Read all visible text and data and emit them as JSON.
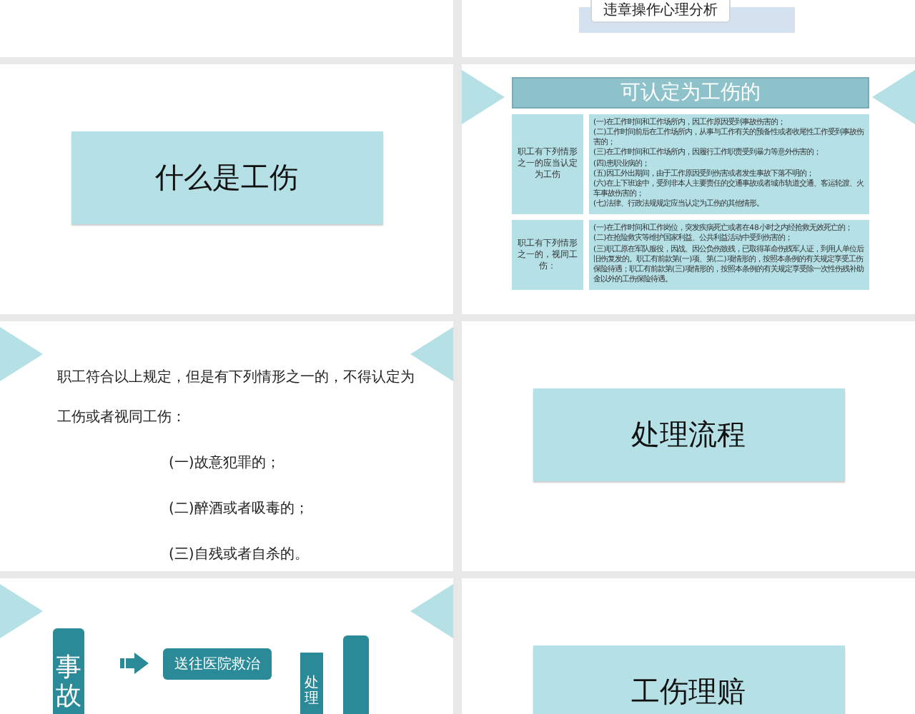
{
  "slides": [
    {
      "kind": "blank"
    },
    {
      "kind": "menu",
      "item": "违章操作心理分析"
    },
    {
      "kind": "title",
      "title": "什么是工伤"
    },
    {
      "kind": "table",
      "title": "可认定为工伤的",
      "rows": [
        {
          "label": "职工有下列情形之一的应当认定为工伤",
          "items": [
            "(一)在工作时间和工作场所内，因工作原因受到事故伤害的；",
            "(二)工作时间前后在工作场所内，从事与工作有关的预备性或者收尾性工作受到事故伤害的；",
            "(三)在工作时间和工作场所内，因履行工作职责受到暴力等意外伤害的；",
            "(四)患职业病的；",
            "(五)因工外出期间，由于工作原因受到伤害或者发生事故下落不明的；",
            "(六)在上下班途中，受到非本人主要责任的交通事故或者城市轨道交通、客运轮渡、火车事故伤害的；",
            "(七)法律、行政法规规定应当认定为工伤的其他情形。"
          ]
        },
        {
          "label": "职工有下列情形之一的，视同工伤：",
          "items": [
            "(一)在工作时间和工作岗位，突发疾病死亡或者在48小时之内经抢救无效死亡的；",
            "(二)在抢险救灾等维护国家利益、公共利益活动中受到伤害的；",
            "(三)职工原在军队服役，因战、因公负伤致残，已取得革命伤残军人证，到用人单位后旧伤复发的。职工有前款第(一)项、第(二)项情形的，按照本条例的有关规定享受工伤保险待遇；职工有前款第(三)项情形的，按照本条例的有关规定享受除一次性伤残补助金以外的工伤保险待遇。"
          ]
        }
      ]
    },
    {
      "kind": "list",
      "intro": "职工符合以上规定，但是有下列情形之一的，不得认定为工伤或者视同工伤：",
      "items": [
        "(一)故意犯罪的；",
        "(二)醉酒或者吸毒的；",
        "(三)自残或者自杀的。"
      ]
    },
    {
      "kind": "title",
      "title": "处理流程"
    },
    {
      "kind": "flow",
      "start": "事故",
      "step": "送往医院救治",
      "branch": "处理"
    },
    {
      "kind": "title",
      "title": "工伤理赔"
    }
  ]
}
